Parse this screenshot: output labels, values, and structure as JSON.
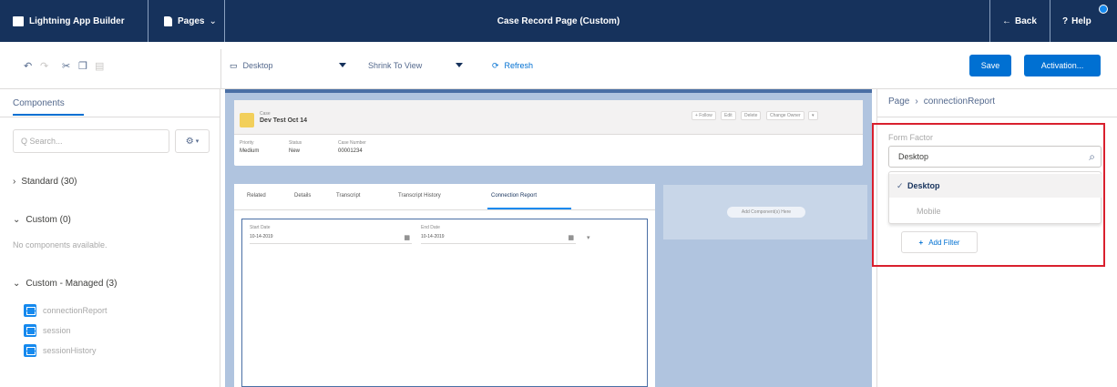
{
  "topbar": {
    "app_label": "Lightning App Builder",
    "pages_label": "Pages",
    "title": "Case Record Page (Custom)",
    "back_label": "Back",
    "help_label": "Help",
    "help_badge_count": "1"
  },
  "toolbar": {
    "device_select": "Desktop",
    "view_select": "Shrink To View",
    "refresh_label": "Refresh",
    "save_label": "Save",
    "activation_label": "Activation..."
  },
  "left_panel": {
    "tab_label": "Components",
    "search_placeholder": "Q Search...",
    "standard_label": "Standard (30)",
    "custom_label": "Custom (0)",
    "custom_empty": "No components available.",
    "managed_label": "Custom - Managed (3)",
    "managed_items": [
      {
        "label": "connectionReport"
      },
      {
        "label": "session"
      },
      {
        "label": "sessionHistory"
      }
    ]
  },
  "canvas": {
    "record_type": "Case",
    "record_name": "Dev Test Oct 14",
    "header_buttons": [
      "+ Follow",
      "Edit",
      "Delete",
      "Change Owner"
    ],
    "fields": [
      {
        "label": "Priority",
        "value": "Medium"
      },
      {
        "label": "Status",
        "value": "New"
      },
      {
        "label": "Case Number",
        "value": "00001234"
      }
    ],
    "tabs": [
      "Related",
      "Details",
      "Transcript",
      "Transcript History",
      "Connection Report"
    ],
    "date_fields": [
      {
        "label": "Start Date",
        "value": "10-14-2019"
      },
      {
        "label": "End Date",
        "value": "10-14-2019"
      }
    ],
    "side_button": "Add Component(s) Here"
  },
  "right_panel": {
    "breadcrumb_page": "Page",
    "breadcrumb_current": "connectionReport",
    "form_factor_label": "Form Factor",
    "form_factor_value": "Desktop",
    "options": [
      {
        "label": "Desktop",
        "selected": true
      },
      {
        "label": "Mobile",
        "selected": false
      }
    ],
    "add_filter_label": "Add Filter"
  },
  "colors": {
    "topbar": "#16325c",
    "brand_blue": "#0070d2",
    "highlight_red": "#d9202e",
    "canvas_bg": "#b0c4df"
  }
}
